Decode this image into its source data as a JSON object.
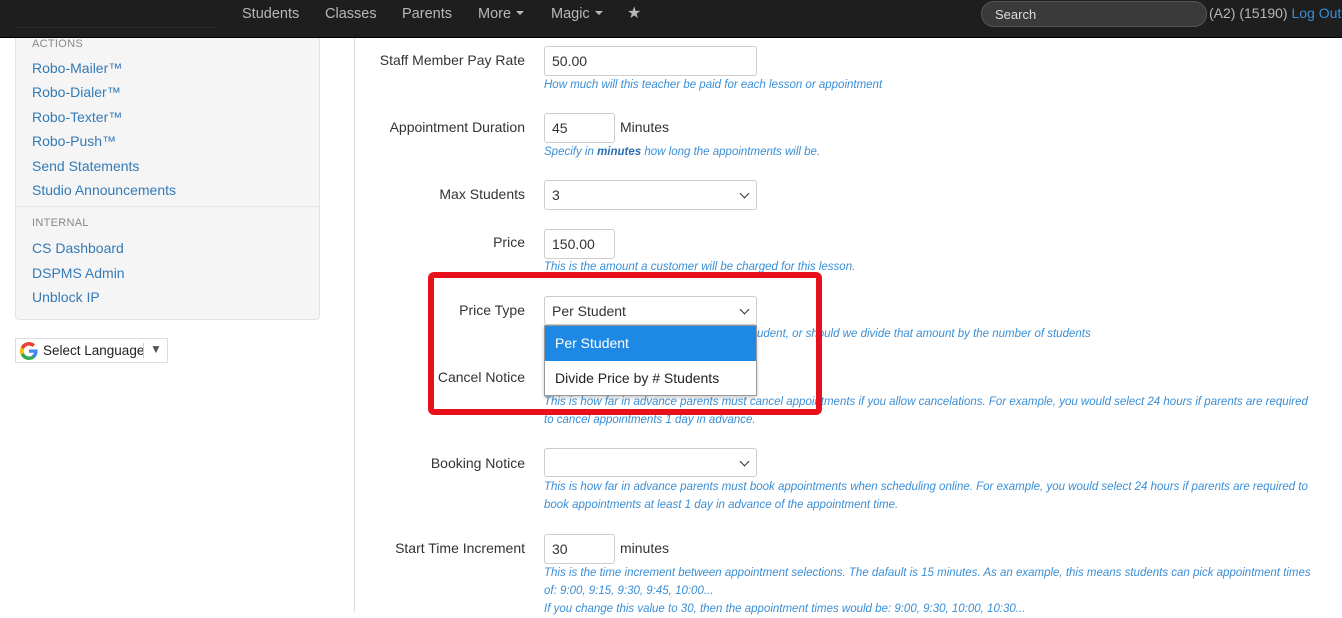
{
  "nav": {
    "items": [
      "Students",
      "Classes",
      "Parents",
      "More",
      "Magic"
    ],
    "search_placeholder": "Search",
    "account_text": "(A2) (15190)",
    "logout_label": "Log Out"
  },
  "sidebar": {
    "actions_header": "ACTIONS",
    "actions": [
      "Robo-Mailer™",
      "Robo-Dialer™",
      "Robo-Texter™",
      "Robo-Push™",
      "Send Statements",
      "Studio Announcements"
    ],
    "internal_header": "INTERNAL",
    "internal": [
      "CS Dashboard",
      "DSPMS Admin",
      "Unblock IP"
    ]
  },
  "translate": {
    "label": "Select Language",
    "arrow": "▼"
  },
  "form": {
    "pay_rate": {
      "label": "Staff Member Pay Rate",
      "value": "50.00",
      "help": "How much will this teacher be paid for each lesson or appointment"
    },
    "duration": {
      "label": "Appointment Duration",
      "value": "45",
      "unit": "Minutes",
      "help_pre": "Specify in ",
      "help_bold": "minutes",
      "help_post": " how long the appointments will be."
    },
    "max_students": {
      "label": "Max Students",
      "value": "3"
    },
    "price": {
      "label": "Price",
      "value": "150.00",
      "help": "This is the amount a customer will be charged for this lesson."
    },
    "price_type": {
      "label": "Price Type",
      "value": "Per Student",
      "help_fragment": "udent, or should we divide that amount by the number of students",
      "options": [
        "Per Student",
        "Divide Price by # Students"
      ]
    },
    "cancel_notice": {
      "label": "Cancel Notice",
      "help_line1": "This is how far in advance parents must cancel appointments if you allow cancelations. For example, you would select 24 hours if parents are required",
      "help_line2": "to cancel appointments 1 day in advance."
    },
    "booking_notice": {
      "label": "Booking Notice",
      "value": "",
      "help_line1": "This is how far in advance parents must book appointments when scheduling online. For example, you would select 24 hours if parents are required to",
      "help_line2": "book appointments at least 1 day in advance of the appointment time."
    },
    "start_increment": {
      "label": "Start Time Increment",
      "value": "30",
      "unit": "minutes",
      "help_line1": "This is the time increment between appointment selections. The dafault is 15 minutes. As an example, this means students can pick appointment times",
      "help_line2": "of: 9:00, 9:15, 9:30, 9:45, 10:00...",
      "help_line3": "If you change this value to 30, then the appointment times would be: 9:00, 9:30, 10:00, 10:30..."
    }
  },
  "colors": {
    "highlight": "#e8101a",
    "selected_option": "#1e88e5",
    "link": "#337ab7"
  }
}
